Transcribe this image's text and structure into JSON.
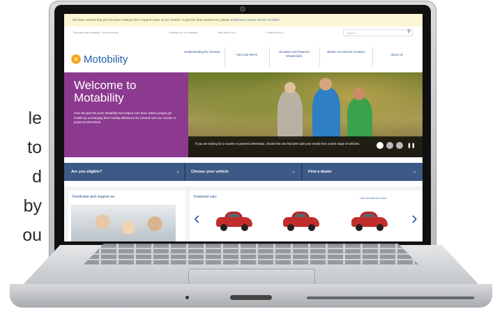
{
  "side_text": {
    "lines": [
      "le",
      "to",
      "d",
      "by",
      "ou"
    ]
  },
  "website": {
    "notice": {
      "text": "We have noticed that your browser settings don't support some of our content. To get the best experience, please",
      "link": "download a newer version of Safari"
    },
    "utility": {
      "left_text": "This site uses cookies. Find out more",
      "contact": "Contact us  Our website",
      "text_size": "Text size  A  A  A",
      "colours": "Colours  A  A  A",
      "search_placeholder": "Search..."
    },
    "brand": "Motobility",
    "nav": [
      "Understanding the Scheme",
      "Cars and WAVs",
      "Scooters and Powered Wheelchairs",
      "What's On and Get Involved",
      "About Us"
    ],
    "hero": {
      "title": "Welcome to Motability",
      "body": "Over the past 35 years Motability has helped over three million people get mobile by exchanging their mobility allowance for a brand new car, scooter or powered wheelchair.",
      "caption": "If you are looking for a scooter or powered wheelchair, choose the one that best suits your needs from a wide range of vehicles."
    },
    "bluebar": [
      "Are you eligible?",
      "Choose your vehicle",
      "Find a dealer"
    ],
    "left_card_title": "Fundraise and support us",
    "featured_title": "Featured cars",
    "view_all": "View all featured cars",
    "colors": {
      "brand_blue": "#1f5fa8",
      "hero_purple": "#8c3a8f",
      "bar_blue": "#3d5a86",
      "car_red": "#c22d2d"
    },
    "icons": [
      "search-icon",
      "chevron-down-icon",
      "arrow-left-icon",
      "arrow-right-icon",
      "pause-icon"
    ]
  }
}
